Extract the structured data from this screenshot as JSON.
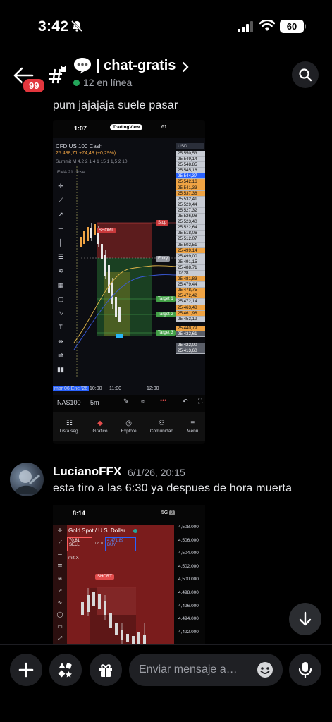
{
  "status_bar": {
    "time": "3:42",
    "battery": "60"
  },
  "header": {
    "back_badge": "99",
    "channel_name": "chat-gratis",
    "channel_prefix": "|",
    "online": "12 en línea"
  },
  "messages": [
    {
      "text": "pum jajajaja suele pasar",
      "attachment": {
        "status_time": "1:07",
        "app_pill": "TradingView",
        "status_battery": "61",
        "symbol": "CFD US 100 Cash",
        "change": "25.488,71 +74,48 (+0,29%)",
        "indicator": "Summit M 4.2 2 1 4 1 15 1 1,5 2 10",
        "ema": "EMA 21 close",
        "currency": "USD",
        "price_labels": [
          "25.550,53",
          "25.549,14",
          "25.548,85",
          "25.545,16",
          "25.544,37",
          "25.542,16",
          "25.541,33",
          "25.537,38",
          "25.532,41",
          "25.529,44",
          "25.527,32",
          "25.526,98",
          "25.523,40",
          "25.522,64",
          "25.518,06",
          "25.512,07",
          "25.502,51",
          "25.499,14",
          "25.499,00",
          "25.491,15",
          "25.488,71",
          "02:28",
          "25.481,83",
          "25.479,44",
          "25.478,75",
          "25.472,42",
          "25.472,14",
          "25.463,48",
          "25.461,98",
          "25.453,19"
        ],
        "price_lower": [
          "25.440,79",
          "25.432,61",
          "",
          "25.422,00",
          "25.413,60"
        ],
        "tags": {
          "stop": "Stop",
          "short": "SHORT",
          "entry": "Entry",
          "target1": "Target 1",
          "target2": "Target 2",
          "target3": "Target 3"
        },
        "x_axis": {
          "date": "mar 06 Ene '26",
          "t1": "10:00",
          "t2": "11:00",
          "t3": "12:00"
        },
        "symbol_bar": {
          "ticker": "NAS100",
          "interval": "5m"
        },
        "tabs": [
          {
            "label": "Lista seg.",
            "icon": "list-icon"
          },
          {
            "label": "Gráfico",
            "icon": "chart-icon"
          },
          {
            "label": "Explore",
            "icon": "compass-icon"
          },
          {
            "label": "Comunidad",
            "icon": "people-icon"
          },
          {
            "label": "Menú",
            "icon": "menu-icon"
          }
        ]
      }
    },
    {
      "author": "LucianoFFX",
      "timestamp": "6/1/26, 20:15",
      "text": "esta tiro a las 6:30 ya despues de hora muerta",
      "attachment": {
        "status_time": "8:14",
        "network": "5G",
        "battery": "7",
        "symbol": "Gold Spot / U.S. Dollar",
        "sell": "70.81",
        "sell_label": "SELL",
        "spread": "108.0",
        "buy": "4,471.89",
        "buy_label": "BUY",
        "indicator": "mit X",
        "short_tag": "SHORT",
        "axis": [
          "4,508.000",
          "4,506.000",
          "4,504.000",
          "4,502.000",
          "4,500.000",
          "4,498.000",
          "4,496.000",
          "4,494.000",
          "4,492.000"
        ]
      }
    }
  ],
  "composer": {
    "placeholder": "Enviar mensaje a…"
  },
  "colors": {
    "online": "#23a55a",
    "badge": "#e2363d",
    "background": "#000000",
    "chip": "#1f2024"
  }
}
